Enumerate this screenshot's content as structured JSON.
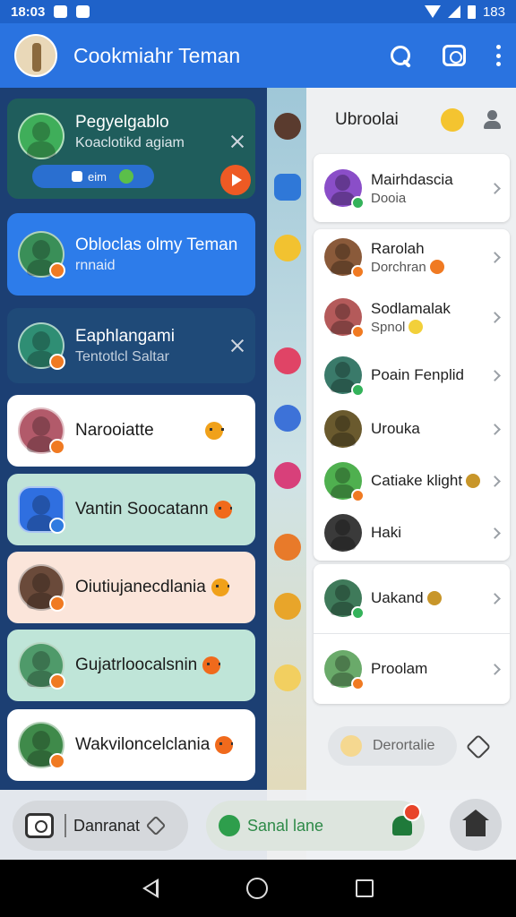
{
  "status_bar": {
    "time": "18:03",
    "battery": "183"
  },
  "app_bar": {
    "title": "Cookmiahr Teman"
  },
  "left_cards": [
    {
      "title": "Pegyelgablo",
      "subtitle": "Koaclotikd agiam",
      "chip": "eim"
    },
    {
      "title": "Obloclas olmy Teman",
      "subtitle": "rnnaid"
    },
    {
      "title": "Eaphlangami",
      "subtitle": "Tentotlcl Saltar"
    },
    {
      "title": "Narooiatte"
    },
    {
      "title": "Vantin Soocatann"
    },
    {
      "title": "Oiutiujanecdlania"
    },
    {
      "title": "Gujatrloocalsnin"
    },
    {
      "title": "Wakviloncelclania"
    }
  ],
  "right_panel": {
    "header_title": "Ubroolai",
    "contacts": [
      {
        "name": "Mairhdascia",
        "sub": "Dooia"
      },
      {
        "name": "Rarolah",
        "sub": "Dorchran"
      },
      {
        "name": "Sodlamalak",
        "sub": "Spnol"
      },
      {
        "name": "Poain Fenplid"
      },
      {
        "name": "Urouka"
      },
      {
        "name": "Catiake klight"
      },
      {
        "name": "Haki"
      },
      {
        "name": "Uakand"
      },
      {
        "name": "Proolam"
      }
    ],
    "pill_label": "Derortalie"
  },
  "bottom_bar": {
    "left_label": "Danranat",
    "center_label": "Sanal lane"
  },
  "colors": {
    "app_bar": "#2a73e0",
    "status_bar": "#1f62c9",
    "left_panel": "#1c3f73",
    "accent_orange": "#f07a22",
    "online_green": "#34b25a"
  }
}
